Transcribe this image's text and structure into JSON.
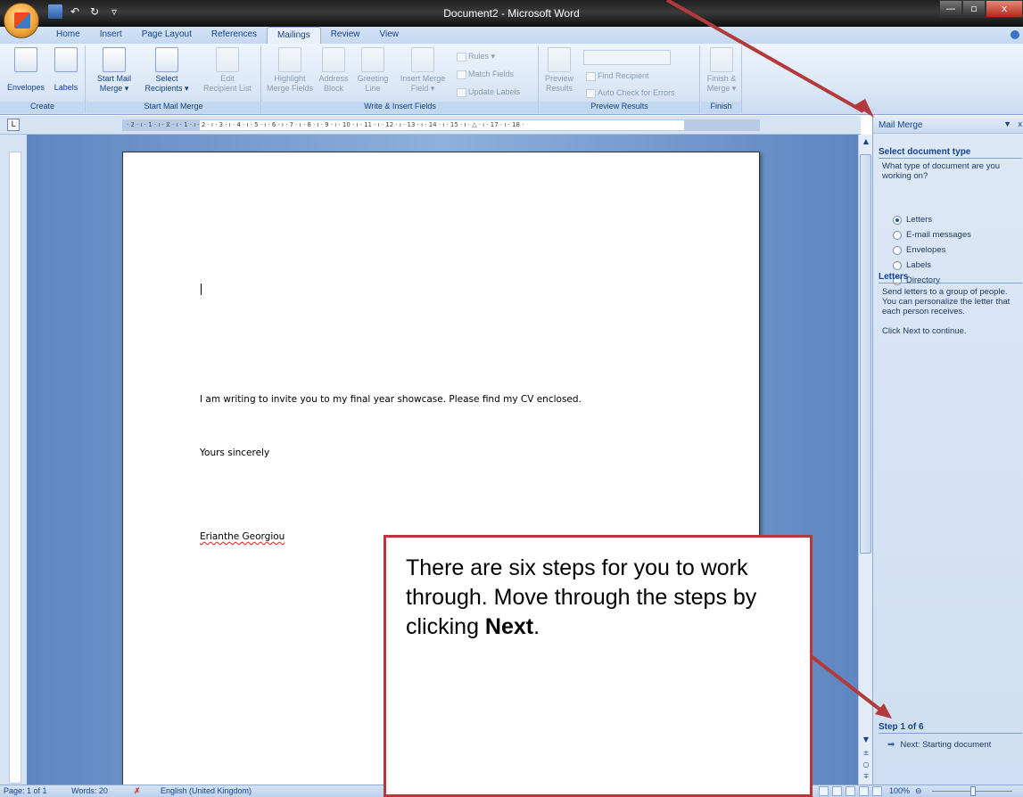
{
  "window": {
    "title": "Document2 - Microsoft Word",
    "minimize": "—",
    "maximize": "▫",
    "close": "x"
  },
  "tabs": [
    "Home",
    "Insert",
    "Page Layout",
    "References",
    "Mailings",
    "Review",
    "View"
  ],
  "active_tab": "Mailings",
  "ribbon": {
    "create": {
      "label": "Create",
      "envelopes": "Envelopes",
      "labels": "Labels"
    },
    "start_mail_merge": {
      "label": "Start Mail Merge",
      "start_mail_merge_1": "Start Mail",
      "start_mail_merge_2": "Merge ▾",
      "select_recipients_1": "Select",
      "select_recipients_2": "Recipients ▾",
      "edit_recipient_list_1": "Edit",
      "edit_recipient_list_2": "Recipient List"
    },
    "write_insert": {
      "label": "Write & Insert Fields",
      "highlight_1": "Highlight",
      "highlight_2": "Merge Fields",
      "address_1": "Address",
      "address_2": "Block",
      "greeting_1": "Greeting",
      "greeting_2": "Line",
      "insert_merge_1": "Insert Merge",
      "insert_merge_2": "Field ▾",
      "rules": "Rules ▾",
      "match_fields": "Match Fields",
      "update_labels": "Update Labels"
    },
    "preview": {
      "label": "Preview Results",
      "preview_1": "Preview",
      "preview_2": "Results",
      "find_recipient": "Find Recipient",
      "auto_check": "Auto Check for Errors"
    },
    "finish": {
      "label": "Finish",
      "finish_1": "Finish &",
      "finish_2": "Merge ▾"
    }
  },
  "ruler": {
    "toggle": "L",
    "marks": "· 2 · ı · 1 · ı · ⧖ · ı · 1 · ı · 2 · ı · 3 · ı · 4 · ı · 5 · ı · 6 · ı · 7 · ı · 8 · ı · 9 · ı · 10 · ı · 11 · ı · 12 · ı · 13 · ı · 14 · ı · 15 · ı · △ · ı · 17 · ı · 18 ·"
  },
  "document": {
    "line1": "I am writing to invite you to my final year showcase.  Please find my CV enclosed.",
    "line2": "Yours sincerely",
    "line3": "Erianthe Georgiou"
  },
  "task_pane": {
    "title": "Mail Merge",
    "menu": "▼",
    "close": "x",
    "section1": "Select document type",
    "question": "What type of document are you working on?",
    "options": [
      "Letters",
      "E-mail messages",
      "Envelopes",
      "Labels",
      "Directory"
    ],
    "selected": "Letters",
    "section2": "Letters",
    "desc": "Send letters to a group of people. You can personalize the letter that each person receives.",
    "hint": "Click Next to continue.",
    "step": "Step 1 of 6",
    "next": "Next: Starting document"
  },
  "status": {
    "page": "Page: 1 of 1",
    "words": "Words: 20",
    "language": "English (United Kingdom)",
    "zoom": "100%",
    "zoom_minus": "⊖"
  },
  "callout": {
    "text_before": "There are six steps for you to work through. Move through the steps by clicking ",
    "bold": "Next",
    "text_after": "."
  },
  "colors": {
    "accent": "#15428b",
    "arrow": "#b33a3a"
  }
}
